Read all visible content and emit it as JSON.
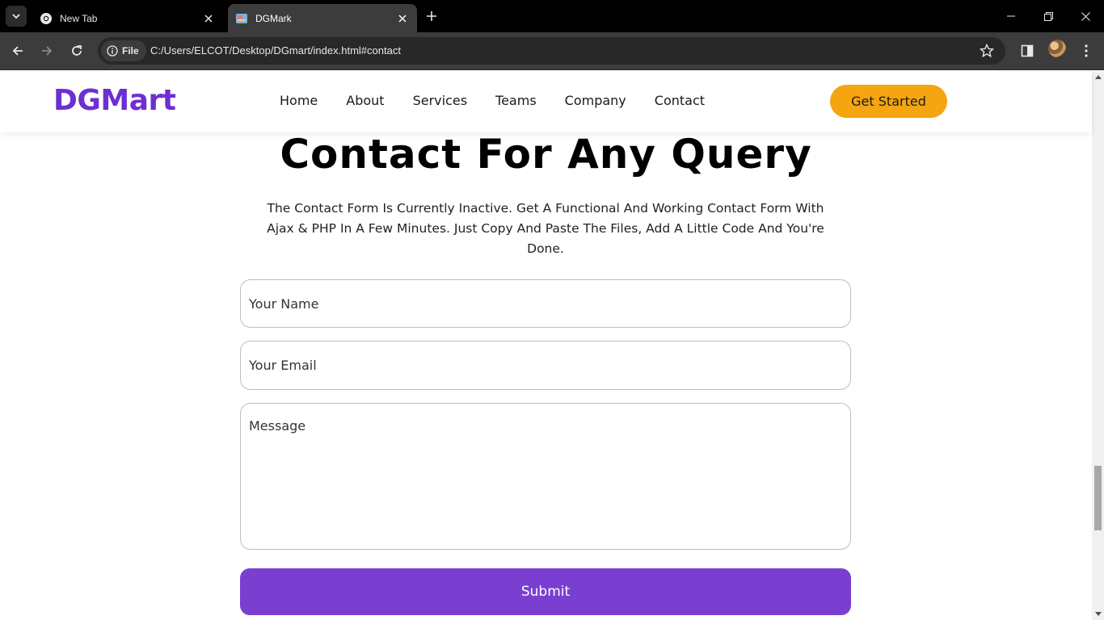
{
  "browser": {
    "tabs": [
      {
        "title": "New Tab",
        "active": false
      },
      {
        "title": "DGMark",
        "active": true
      }
    ],
    "url_scheme_chip": "File",
    "url": "C:/Users/ELCOT/Desktop/DGmart/index.html#contact"
  },
  "header": {
    "logo": "DGMart",
    "nav": [
      "Home",
      "About",
      "Services",
      "Teams",
      "Company",
      "Contact"
    ],
    "cta": "Get Started"
  },
  "contact": {
    "title": "Contact For Any Query",
    "description": "The Contact Form Is Currently Inactive. Get A Functional And Working Contact Form With Ajax & PHP In A Few Minutes. Just Copy And Paste The Files, Add A Little Code And You're Done.",
    "name_placeholder": "Your Name",
    "email_placeholder": "Your Email",
    "message_placeholder": "Message",
    "submit": "Submit"
  },
  "colors": {
    "brand": "#6d2fd1",
    "cta": "#f4a50f",
    "submit": "#7a3fd1"
  }
}
